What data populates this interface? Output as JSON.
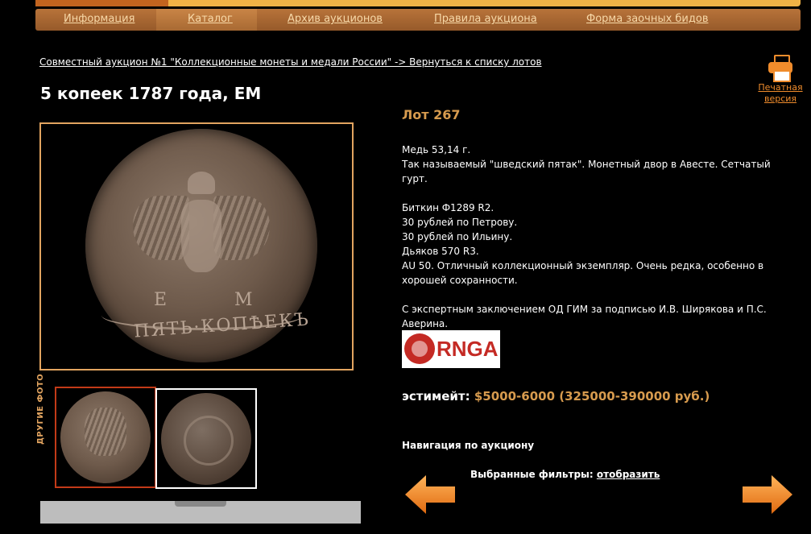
{
  "nav": {
    "items": [
      {
        "label": "Информация"
      },
      {
        "label": "Каталог"
      },
      {
        "label": "Архив аукционов"
      },
      {
        "label": "Правила аукциона"
      },
      {
        "label": "Форма заочных бидов"
      }
    ]
  },
  "breadcrumb": "Совместный аукцион №1 \"Коллекционные монеты и медали России\" -> Вернуться к списку лотов",
  "print": {
    "label_line1": "Печатная",
    "label_line2": "версия",
    "icon": "printer-icon"
  },
  "lot": {
    "title": "5 копеек 1787 года, ЕМ",
    "number_label": "Лот 267",
    "coin_letters": {
      "left": "Е",
      "right": "М"
    },
    "coin_legend": "ПЯТЬ·КОПѢЕКЪ",
    "description": [
      "Медь 53,14 г.",
      "Так называемый \"шведский пятак\". Монетный двор в Авесте. Сетчатый гурт.",
      "",
      "Биткин Ф1289 R2.",
      "30 рублей по Петрову.",
      "30 рублей по Ильину.",
      "Дьяков 570 R3.",
      "AU 50. Отличный коллекционный экземпляр. Очень редка, особенно в хорошей сохранности.",
      "",
      "С экспертным заключением ОД ГИМ за подписью И.В. Ширякова и П.С. Аверина."
    ],
    "grading_logo": "RNGA",
    "estimate_label": "эстимейт:",
    "estimate_value": "$5000-6000 (325000-390000 руб.)"
  },
  "gallery": {
    "other_photos_label": "ДРУГИЕ ФОТО"
  },
  "auction_nav": {
    "title": "Навигация по аукциону",
    "filters_label": "Выбранные фильтры:",
    "filters_link": "отобразить"
  },
  "colors": {
    "accent": "#d79b4e",
    "nav_bg": "#a86a33",
    "arrow": "#f08c2c"
  }
}
